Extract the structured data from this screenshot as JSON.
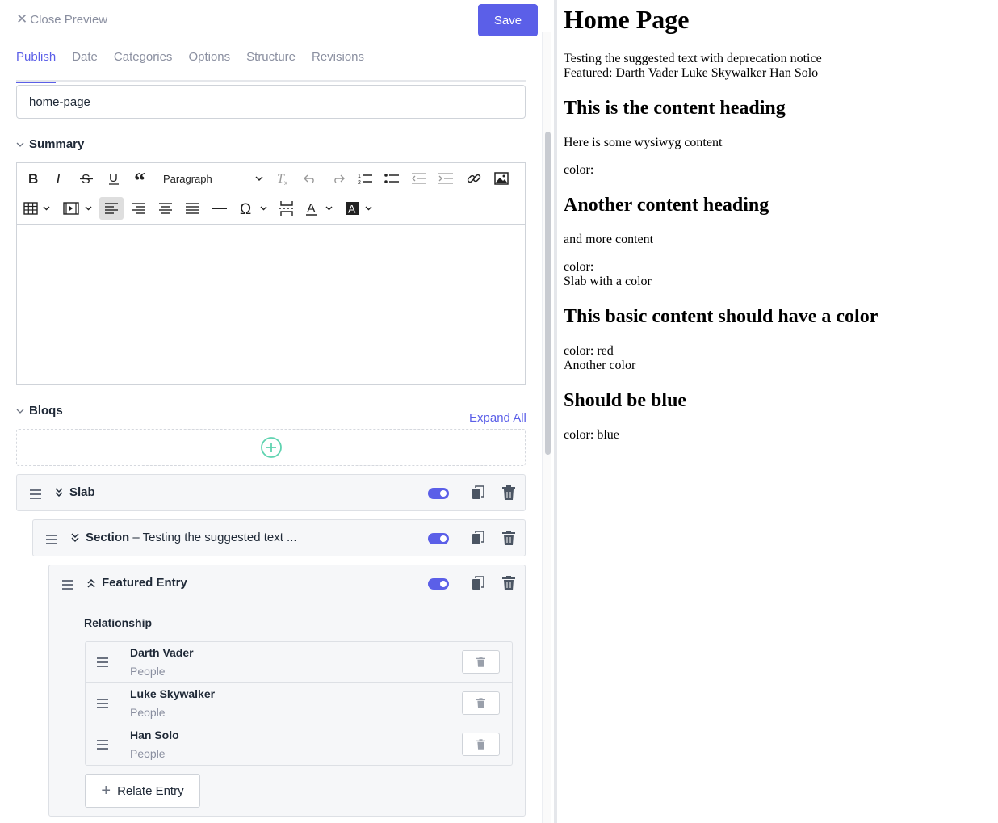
{
  "header": {
    "close_label": "Close Preview",
    "save_label": "Save"
  },
  "tabs": [
    {
      "label": "Publish",
      "active": true
    },
    {
      "label": "Date",
      "active": false
    },
    {
      "label": "Categories",
      "active": false
    },
    {
      "label": "Options",
      "active": false
    },
    {
      "label": "Structure",
      "active": false
    },
    {
      "label": "Revisions",
      "active": false
    }
  ],
  "slug": {
    "value": "home-page"
  },
  "summary": {
    "label": "Summary",
    "format_select": "Paragraph"
  },
  "bloqs": {
    "label": "Bloqs",
    "expand_all": "Expand All",
    "slab": {
      "title": "Slab",
      "enabled": true
    },
    "section": {
      "title": "Section",
      "subtitle": "– Testing the suggested text ...",
      "enabled": true
    },
    "featured": {
      "title": "Featured Entry",
      "enabled": true,
      "relationship_label": "Relationship",
      "entries": [
        {
          "name": "Darth Vader",
          "type": "People"
        },
        {
          "name": "Luke Skywalker",
          "type": "People"
        },
        {
          "name": "Han Solo",
          "type": "People"
        }
      ],
      "relate_label": "Relate Entry"
    }
  },
  "preview": {
    "title": "Home Page",
    "intro_line1": "Testing the suggested text with deprecation notice",
    "intro_line2": "Featured: Darth Vader Luke Skywalker Han Solo",
    "heading1": "This is the content heading",
    "para1": "Here is some wysiwyg content",
    "color1": "color:",
    "heading2": "Another content heading",
    "para2": "and more content",
    "color2": "color:",
    "slab_color": "Slab with a color",
    "heading3": "This basic content should have a color",
    "color3": "color: red",
    "another_color": "Another color",
    "heading4": "Should be blue",
    "color4": "color: blue"
  },
  "colors": {
    "accent": "#5b5fe8",
    "add_icon": "#5fd3b0",
    "muted_text": "#8a8fa0"
  }
}
